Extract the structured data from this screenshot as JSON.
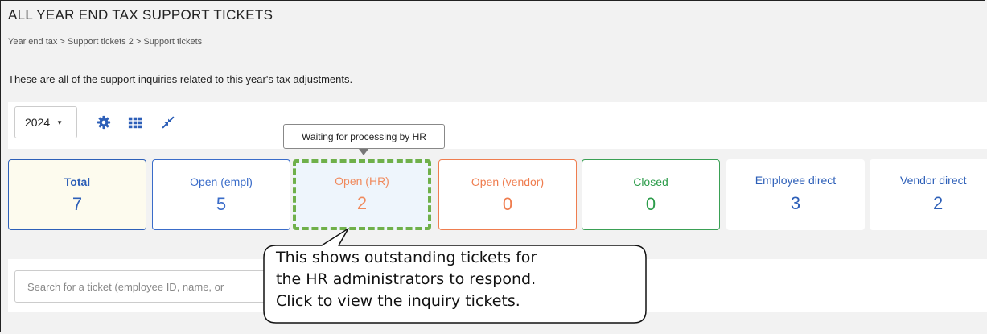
{
  "header": {
    "title": "ALL YEAR END TAX SUPPORT TICKETS",
    "breadcrumb": "Year end tax > Support tickets 2 > Support tickets",
    "description": "These are all of the support inquiries related to this year's tax adjustments."
  },
  "toolbar": {
    "year": "2024",
    "icons": [
      "gear-icon",
      "grid-icon",
      "collapse-arrows-icon"
    ],
    "accent_color": "#2d5fb8"
  },
  "tooltip": {
    "text": "Waiting for processing by HR"
  },
  "summary_cards": [
    {
      "label": "Total",
      "count": "7",
      "color": "#2d5fb8"
    },
    {
      "label": "Open (empl)",
      "count": "5",
      "color": "#3a6cc9"
    },
    {
      "label": "Open (HR)",
      "count": "2",
      "color": "#f08a5d"
    },
    {
      "label": "Open (vendor)",
      "count": "0",
      "color": "#ef7d4f"
    },
    {
      "label": "Closed",
      "count": "0",
      "color": "#2c9c4a"
    },
    {
      "label": "Employee direct",
      "count": "3",
      "color": "#2d5fb8"
    },
    {
      "label": "Vendor direct",
      "count": "2",
      "color": "#2d5fb8"
    }
  ],
  "search": {
    "placeholder": "Search for a ticket (employee ID, name, or"
  },
  "callout": {
    "lines": [
      "This shows outstanding tickets for",
      "the HR administrators to respond.",
      "Click to view the inquiry tickets."
    ],
    "highlight_color": "#6fb04a"
  }
}
